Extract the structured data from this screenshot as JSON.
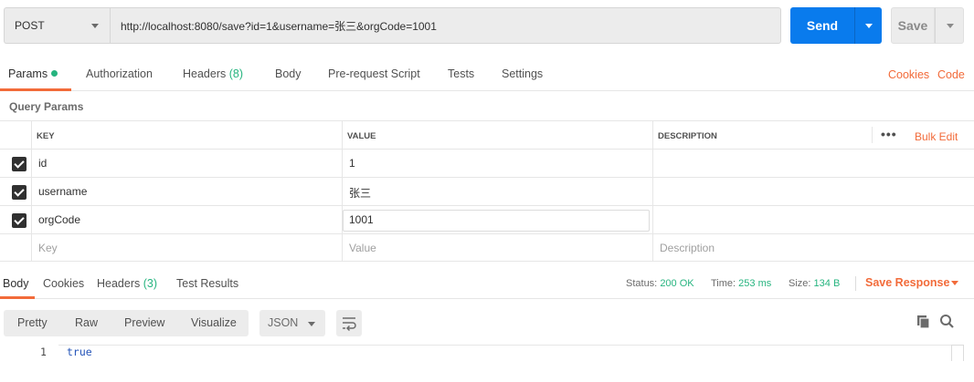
{
  "request": {
    "method": "POST",
    "url": "http://localhost:8080/save?id=1&username=张三&orgCode=1001",
    "send_label": "Send",
    "save_label": "Save"
  },
  "tabs": {
    "params": "Params",
    "authorization": "Authorization",
    "headers": "Headers",
    "headers_count": "(8)",
    "body": "Body",
    "prerequest": "Pre-request Script",
    "tests": "Tests",
    "settings": "Settings",
    "cookies": "Cookies",
    "code": "Code"
  },
  "query_params": {
    "title": "Query Params",
    "columns": {
      "key": "KEY",
      "value": "VALUE",
      "description": "DESCRIPTION"
    },
    "bulk_edit": "Bulk Edit",
    "rows": [
      {
        "key": "id",
        "value": "1",
        "checked": true
      },
      {
        "key": "username",
        "value": "张三",
        "checked": true
      },
      {
        "key": "orgCode",
        "value": "1001",
        "checked": true
      }
    ],
    "placeholders": {
      "key": "Key",
      "value": "Value",
      "description": "Description"
    }
  },
  "response": {
    "tabs": {
      "body": "Body",
      "cookies": "Cookies",
      "headers": "Headers",
      "headers_count": "(3)",
      "test_results": "Test Results"
    },
    "status_label": "Status:",
    "status_value": "200 OK",
    "time_label": "Time:",
    "time_value": "253 ms",
    "size_label": "Size:",
    "size_value": "134 B",
    "save_response": "Save Response",
    "formats": [
      "Pretty",
      "Raw",
      "Preview",
      "Visualize"
    ],
    "language": "JSON",
    "lines": [
      {
        "num": "1",
        "text": "true"
      }
    ]
  },
  "colors": {
    "accent": "#f26b3a",
    "primary": "#097bed",
    "success": "#26b47f"
  },
  "icons": [
    "chevron-down-icon",
    "dropdown-caret-icon",
    "more-dots-icon",
    "checkbox-checked-icon",
    "wrap-lines-icon",
    "copy-icon",
    "search-icon"
  ]
}
